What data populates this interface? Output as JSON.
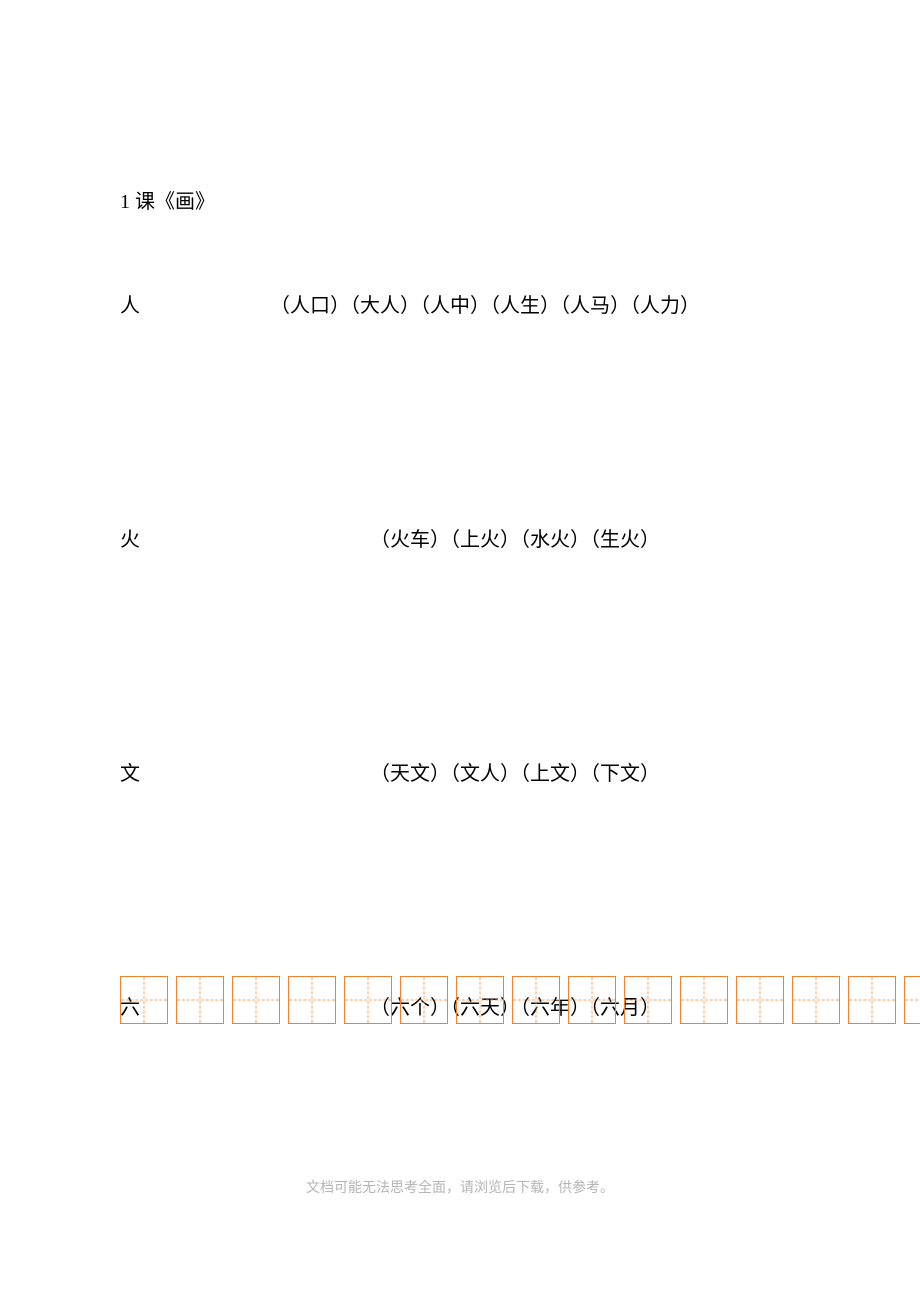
{
  "title": "1 课《画》",
  "entries": [
    {
      "char": "人",
      "words": "（人口）（大人）（人中）（人生）（人马）（人力）"
    },
    {
      "char": "火",
      "words": "（火车）（上火）（水火）（生火）"
    },
    {
      "char": "文",
      "words": "（天文）（文人）（上文）（下文）"
    },
    {
      "char": "六",
      "words": "（六个）（六天）（六年）（六月）"
    }
  ],
  "grid": {
    "cells": 14,
    "has_partial_last": true
  },
  "footer": "文档可能无法思考全面，请浏览后下载，供参考。"
}
